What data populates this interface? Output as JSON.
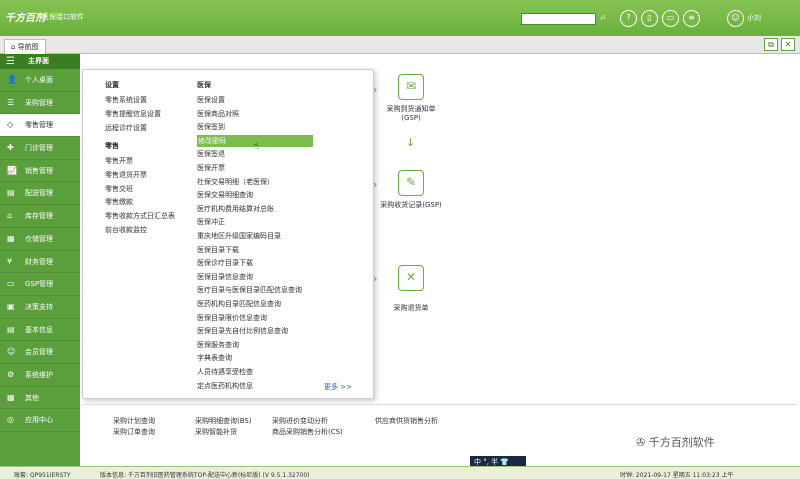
{
  "app": {
    "logo": "千方百剂",
    "subtitle": "医保接口软件",
    "search_placeholder": "",
    "username": "小刘",
    "header_icons": [
      "help-icon",
      "phone-icon",
      "monitor-icon",
      "user-icon"
    ]
  },
  "tabs": [
    {
      "label": "导航图"
    }
  ],
  "window_buttons": [
    "restore-icon",
    "close-icon"
  ],
  "sidebar": {
    "header": "主界面",
    "items": [
      {
        "label": "个人桌面",
        "icon": "person-icon",
        "glyph": "👤"
      },
      {
        "label": "采购管理",
        "icon": "purchase-icon",
        "glyph": "☰"
      },
      {
        "label": "零售管理",
        "icon": "retail-icon",
        "glyph": "◇",
        "active": true
      },
      {
        "label": "门诊管理",
        "icon": "clinic-icon",
        "glyph": "✚"
      },
      {
        "label": "销售管理",
        "icon": "sales-icon",
        "glyph": "📈"
      },
      {
        "label": "配送管理",
        "icon": "delivery-icon",
        "glyph": "▤"
      },
      {
        "label": "库存管理",
        "icon": "stock-icon",
        "glyph": "⌂"
      },
      {
        "label": "仓储管理",
        "icon": "warehouse-icon",
        "glyph": "▦"
      },
      {
        "label": "财务管理",
        "icon": "finance-icon",
        "glyph": "¥"
      },
      {
        "label": "GSP管理",
        "icon": "gsp-icon",
        "glyph": "▭"
      },
      {
        "label": "决策支持",
        "icon": "decision-icon",
        "glyph": "▣"
      },
      {
        "label": "基本信息",
        "icon": "info-icon",
        "glyph": "▤"
      },
      {
        "label": "会员管理",
        "icon": "member-icon",
        "glyph": "☺"
      },
      {
        "label": "系统维护",
        "icon": "gear-icon",
        "glyph": "⚙"
      },
      {
        "label": "其他",
        "icon": "grid-icon",
        "glyph": "▦"
      },
      {
        "label": "应用中心",
        "icon": "app-center-icon",
        "glyph": "◎"
      }
    ]
  },
  "dropdown": {
    "col1": [
      {
        "head": "设置",
        "items": [
          "零售系统设置",
          "零售提醒信息设置",
          "远程诊疗设置"
        ]
      },
      {
        "head": "零售",
        "items": [
          "零售开票",
          "零售退货开票",
          "零售交班",
          "零售缴款",
          "零售收款方式日汇总表",
          "前台收款监控"
        ]
      }
    ],
    "col2": {
      "head": "医保",
      "items": [
        "医保设置",
        "医保商品对照",
        "医保签到",
        "修改密码",
        "医保签退",
        "医保开票",
        "社保交易明细（老医保）",
        "医保交易明细查询",
        "医疗机构费用结算对总账",
        "医保冲正",
        "重庆地区升级国家编码目录",
        "医保目录下载",
        "医保诊疗目录下载",
        "医保目录信息查询",
        "医疗目录与医保目录匹配信息查询",
        "医药机构目录匹配信息查询",
        "医保目录限价信息查询",
        "医保目录先自付比例信息查询",
        "医保服务查询",
        "字典表查询",
        "人员待遇享受检查",
        "定点医药机构信息"
      ],
      "highlighted": 3
    },
    "more": "更多 >>"
  },
  "flow": [
    {
      "label": "采购到货通知单",
      "sub": "(GSP)",
      "icon": "receipt-icon",
      "glyph": "✉"
    },
    {
      "label": "采购收货记录(GSP)",
      "sub": "",
      "icon": "pill-icon",
      "glyph": "✎"
    },
    {
      "label": "采购退货单",
      "sub": "",
      "icon": "box-return-icon",
      "glyph": "✕"
    }
  ],
  "bottom_links": [
    [
      "采购计划查询",
      "采购订单查询"
    ],
    [
      "采购明细查询(BS)",
      "采购智能补货"
    ],
    [
      "采购进价变动分析",
      "商品采购销售分析(CS)"
    ],
    [
      "供应商供货销售分析"
    ]
  ],
  "watermark": "千方百剂软件",
  "ime": "中 °, 半 👕",
  "status": {
    "account": "账套: QP951IERSTY",
    "version": "版本信息: 千方百剂旧医药管理系统TOP-配送中心新(标尼版) (V 9.5.1.32700)",
    "time": "时钟: 2021-09-17 星期五 11:03:23 上午"
  }
}
